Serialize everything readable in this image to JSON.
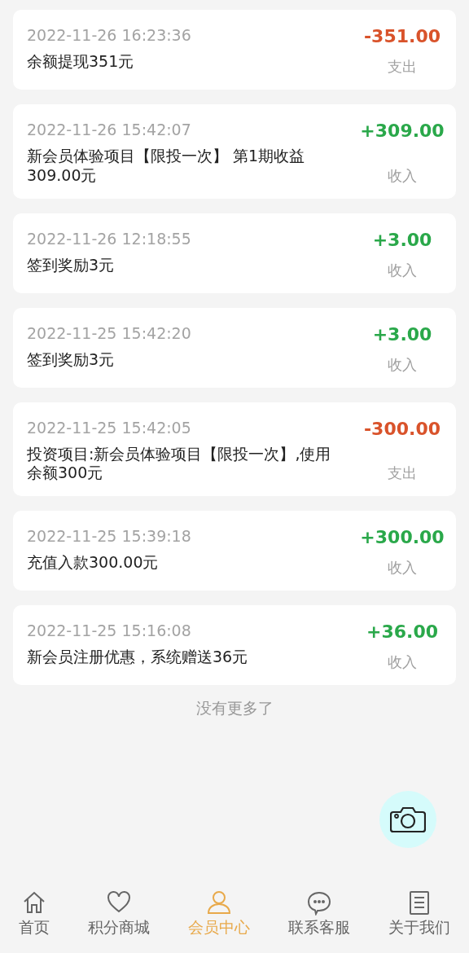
{
  "records": [
    {
      "time": "2022-11-26 16:23:36",
      "description": "余额提现351元",
      "amount": "-351.00",
      "type": "支出",
      "kind": "expense"
    },
    {
      "time": "2022-11-26 15:42:07",
      "description": "新会员体验项目【限投一次】 第1期收益309.00元",
      "amount": "+309.00",
      "type": "收入",
      "kind": "income"
    },
    {
      "time": "2022-11-26 12:18:55",
      "description": "签到奖励3元",
      "amount": "+3.00",
      "type": "收入",
      "kind": "income"
    },
    {
      "time": "2022-11-25 15:42:20",
      "description": "签到奖励3元",
      "amount": "+3.00",
      "type": "收入",
      "kind": "income"
    },
    {
      "time": "2022-11-25 15:42:05",
      "description": "投资项目:新会员体验项目【限投一次】,使用余额300元",
      "amount": "-300.00",
      "type": "支出",
      "kind": "expense"
    },
    {
      "time": "2022-11-25 15:39:18",
      "description": "充值入款300.00元",
      "amount": "+300.00",
      "type": "收入",
      "kind": "income"
    },
    {
      "time": "2022-11-25 15:16:08",
      "description": "新会员注册优惠，系统赠送36元",
      "amount": "+36.00",
      "type": "收入",
      "kind": "income"
    }
  ],
  "end_note": "没有更多了",
  "tab_bar": [
    {
      "label": "首页",
      "selected": false
    },
    {
      "label": "积分商城",
      "selected": false
    },
    {
      "label": "会员中心",
      "selected": true
    },
    {
      "label": "联系客服",
      "selected": false
    },
    {
      "label": "关于我们",
      "selected": false
    }
  ]
}
